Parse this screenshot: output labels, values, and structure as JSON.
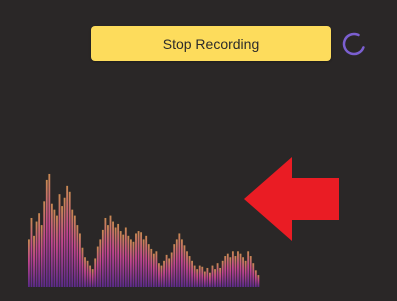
{
  "toolbar": {
    "record_button_label": "Stop Recording",
    "record_button_color": "#fddc5c",
    "spinner_icon": "loading-spinner-icon",
    "spinner_color": "#7b5fd0"
  },
  "audio_visualizer": {
    "bar_levels": [
      0.4,
      0.58,
      0.43,
      0.55,
      0.62,
      0.52,
      0.72,
      0.9,
      0.95,
      0.7,
      0.65,
      0.6,
      0.78,
      0.68,
      0.75,
      0.85,
      0.8,
      0.65,
      0.6,
      0.52,
      0.45,
      0.33,
      0.25,
      0.22,
      0.18,
      0.15,
      0.24,
      0.34,
      0.4,
      0.48,
      0.58,
      0.52,
      0.6,
      0.55,
      0.5,
      0.53,
      0.47,
      0.44,
      0.5,
      0.43,
      0.4,
      0.38,
      0.45,
      0.47,
      0.46,
      0.4,
      0.43,
      0.36,
      0.32,
      0.28,
      0.3,
      0.2,
      0.18,
      0.22,
      0.27,
      0.24,
      0.29,
      0.36,
      0.4,
      0.45,
      0.4,
      0.35,
      0.3,
      0.26,
      0.22,
      0.18,
      0.15,
      0.18,
      0.17,
      0.13,
      0.16,
      0.12,
      0.18,
      0.15,
      0.2,
      0.16,
      0.22,
      0.26,
      0.28,
      0.25,
      0.3,
      0.26,
      0.3,
      0.28,
      0.25,
      0.22,
      0.3,
      0.26,
      0.2,
      0.14,
      0.1
    ],
    "top_color": "#c98a52",
    "mid_color": "#c2458f",
    "bottom_color": "#5b2a8a",
    "background": "#2a2727"
  },
  "annotation": {
    "arrow_icon": "red-pointer-arrow-icon",
    "arrow_color": "#ea1c24",
    "direction": "left"
  }
}
